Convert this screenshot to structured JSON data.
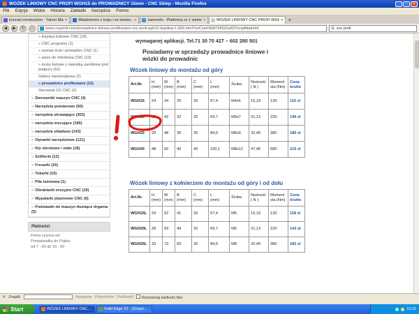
{
  "window": {
    "title": "WÓZEK LINIOWY CNC PROFI WGH15 do PROWADNICY 15mm - CNC Sklep - Mozilla Firefox"
  },
  "menubar": [
    "Plik",
    "Edycja",
    "Widok",
    "Historia",
    "Zakładki",
    "Narzędzia",
    "Pomoc"
  ],
  "tabs": [
    {
      "label": "konrad.construction - Yahoo Mail",
      "active": false
    },
    {
      "label": "Wiadomości z kraju i ze świata - najnows...",
      "active": false
    },
    {
      "label": "Jamendo - Platforma nr 1 wolnej muzyki...",
      "active": false
    },
    {
      "label": "WÓZEK LINIOWY CNC PROFI WGH15 do...",
      "active": true
    }
  ],
  "address": {
    "url": "www.cncprofi.com/prowadnice-liniowe-profilowane-cnc-profi-pgh15-duplikat-1-666.html?osCsid=5b8764532a497ecqdfdatnl44"
  },
  "search": {
    "value": "cnc profi"
  },
  "sidebar": {
    "subitems": [
      "» łożyska kulkowe CNC (18)",
      "» CNC programy (1)",
      "» zestaw śrub i prowadnic CNC (1)",
      "» węże do chłodziwa CNC (10)",
      "» śruby kulowe z nakrętką zarobione pod podpory (52)",
      "Osłony harmonijkowe (2)",
      "» prowadnice profilowane (12)",
      "Sterownik D2 CNC (2)"
    ],
    "active_subitem_index": 6,
    "categories": [
      "Sterowniki maszyn CNC (4)",
      "Narzędzia pomiarowe (60)",
      "narzędzia skrawające (303)",
      "narzędzia mocujące (185)",
      "narzędzia składane (143)",
      "Oprawki narzędziowe (121)",
      "Kły obrotowe i stałe (18)",
      "Szlifierki (12)",
      "Frezarki (16)",
      "Tokarki (19)",
      "Piła taśmowa (1)",
      "Obrabiarki erozyjne CNC (19)",
      "Wypalarki plazmowe CNC (6)",
      "Podstawki do maszyn tłumiące drgania (5)"
    ],
    "payments_title": "Płatności",
    "hours": [
      "Firma czynna od",
      "Poniedziałku do Piątku",
      "od 7 : 00 do 15 : 00"
    ]
  },
  "main": {
    "contact": "wymaganej aplikacji. Tel.71 30 70 427 – 602 280 501",
    "offer": [
      "Posiadamy w sprzedaży prowadnice liniowe i",
      "wózki do prowadnic"
    ],
    "table1": {
      "title": "Wózek liniowy do montażu od góry",
      "headers": [
        "Art.Nr.",
        "H\n(mm)",
        "W\n(mm)",
        "B\n(mm)",
        "C\n(mm)",
        "L\n(mm)",
        "Śruba",
        "Nośność\n( N )",
        "Moment\nsta (Nm)",
        "Cena\nbrutto"
      ],
      "rows": [
        [
          "WGH15",
          "24",
          "34",
          "26",
          "26",
          "57,4",
          "M4x6",
          "16,19",
          "130",
          "115 zł"
        ],
        [
          "WGH20",
          "28",
          "42",
          "32",
          "32",
          "69,7",
          "M5x7",
          "21,13",
          "220",
          "140 zł"
        ],
        [
          "WGH25",
          "33",
          "48",
          "35",
          "35",
          "84,6",
          "M6x9",
          "32,40",
          "380",
          "180 zł"
        ],
        [
          "WGH30",
          "48",
          "60",
          "40",
          "40",
          "100,1",
          "M8x12",
          "47,46",
          "680",
          "215 zł"
        ]
      ]
    },
    "table2": {
      "title": "Wózek liniowy z kołnierzem do montażu od góry i od dołu",
      "headers": [
        "Art.Nr.",
        "H\n(mm)",
        "W\n(mm)",
        "B\n(mm)",
        "C\n(mm)",
        "L\n(mm)",
        "Śruba",
        "Nośność\n( N )",
        "Moment\nsta (Nm)",
        "Cena\nbrutto"
      ],
      "rows": [
        [
          "WGH15L",
          "24",
          "52",
          "41",
          "26",
          "57,4",
          "M5",
          "16,19",
          "130",
          "118 zł"
        ],
        [
          "WGH20L",
          "28",
          "59",
          "49",
          "32",
          "69,7",
          "M6",
          "21,13",
          "220",
          "143 zł"
        ],
        [
          "WGH25L",
          "33",
          "73",
          "60",
          "35",
          "84,6",
          "M8",
          "32,40",
          "380",
          "183 zł"
        ]
      ]
    }
  },
  "findbar": {
    "close": "✕",
    "label": "Znajdź:",
    "next": "Następne",
    "prev": "Poprzednie",
    "highlight": "Podświetl",
    "matchcase": "Rozróżniaj wielkość liter"
  },
  "taskbar": {
    "start": "Start",
    "items": [
      "WÓZEK LINIOWY CNC...",
      "Solid Edge ST - [Zespó..."
    ],
    "clock": "10:31"
  },
  "colors": {
    "accent": "#2d5aa0",
    "price": "#1e4fa8",
    "annotation": "#e01818"
  }
}
